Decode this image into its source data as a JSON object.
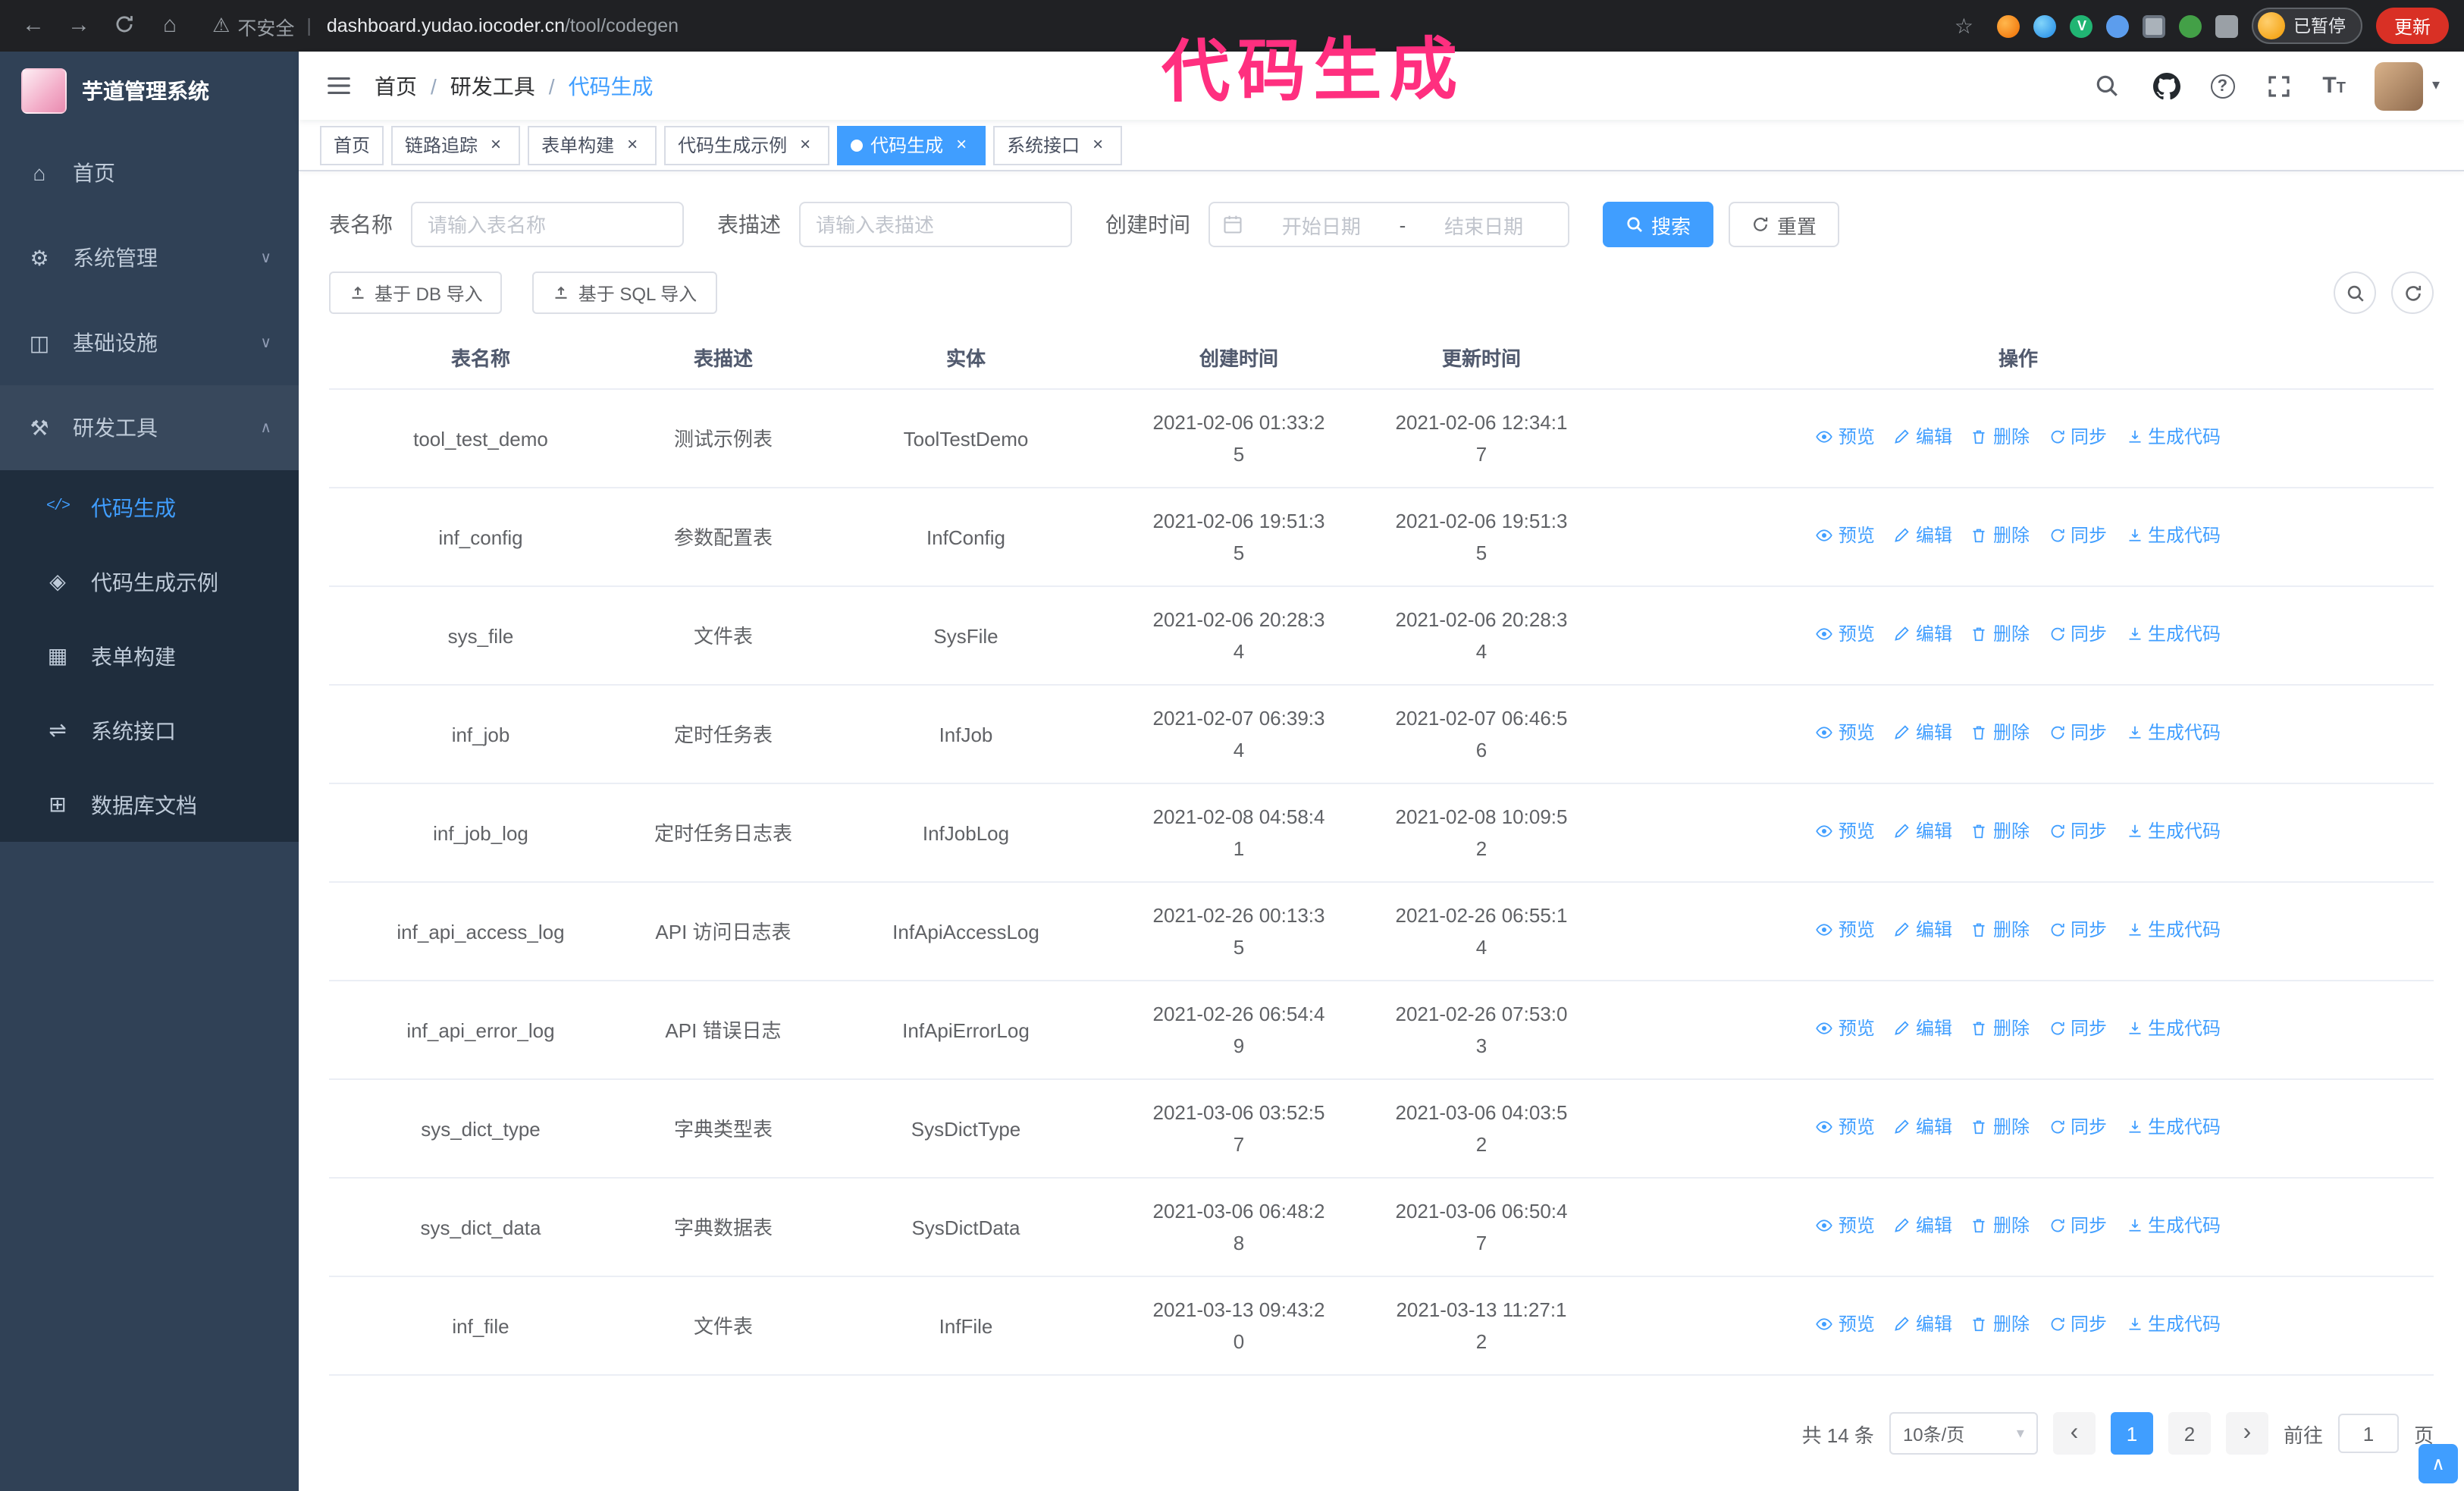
{
  "browser": {
    "security_label": "不安全",
    "url_host": "dashboard.yudao.iocoder.cn",
    "url_path": "/tool/codegen",
    "paused_badge": "已暂停",
    "update_button": "更新"
  },
  "annotation": {
    "text": "代码生成",
    "color": "#ff2f7f"
  },
  "sidebar": {
    "logo_title": "芋道管理系统",
    "items": [
      {
        "name": "home",
        "label": "首页",
        "icon": "home-icon",
        "glyph": "⌂"
      },
      {
        "name": "system-management",
        "label": "系统管理",
        "icon": "gear-icon",
        "glyph": "⚙",
        "chevron": "down"
      },
      {
        "name": "infrastructure",
        "label": "基础设施",
        "icon": "infrastructure-icon",
        "glyph": "◫",
        "chevron": "down"
      },
      {
        "name": "dev-tools",
        "label": "研发工具",
        "icon": "tools-icon",
        "glyph": "⚒",
        "chevron": "up",
        "expanded": true
      }
    ],
    "submenu": [
      {
        "name": "codegen",
        "label": "代码生成",
        "icon": "code-icon",
        "glyph": "</>",
        "active": true
      },
      {
        "name": "codegen-example",
        "label": "代码生成示例",
        "icon": "example-icon",
        "glyph": "◈"
      },
      {
        "name": "form-builder",
        "label": "表单构建",
        "icon": "form-icon",
        "glyph": "▦"
      },
      {
        "name": "system-api",
        "label": "系统接口",
        "icon": "api-icon",
        "glyph": "⇌"
      },
      {
        "name": "db-doc",
        "label": "数据库文档",
        "icon": "db-doc-icon",
        "glyph": "⊞"
      }
    ]
  },
  "header": {
    "breadcrumb": [
      "首页",
      "研发工具",
      "代码生成"
    ]
  },
  "tabs": [
    {
      "label": "首页",
      "closable": false,
      "active": false
    },
    {
      "label": "链路追踪",
      "closable": true,
      "active": false
    },
    {
      "label": "表单构建",
      "closable": true,
      "active": false
    },
    {
      "label": "代码生成示例",
      "closable": true,
      "active": false
    },
    {
      "label": "代码生成",
      "closable": true,
      "active": true
    },
    {
      "label": "系统接口",
      "closable": true,
      "active": false
    }
  ],
  "filters": {
    "table_name_label": "表名称",
    "table_name_placeholder": "请输入表名称",
    "table_desc_label": "表描述",
    "table_desc_placeholder": "请输入表描述",
    "create_time_label": "创建时间",
    "date_start_placeholder": "开始日期",
    "date_separator": "-",
    "date_end_placeholder": "结束日期",
    "search_button": "搜索",
    "reset_button": "重置"
  },
  "toolbar": {
    "import_db_button": "基于 DB 导入",
    "import_sql_button": "基于 SQL 导入"
  },
  "table": {
    "columns": [
      "表名称",
      "表描述",
      "实体",
      "创建时间",
      "更新时间",
      "操作"
    ],
    "actions": [
      {
        "label": "预览",
        "icon": "eye-icon"
      },
      {
        "label": "编辑",
        "icon": "edit-icon"
      },
      {
        "label": "删除",
        "icon": "delete-icon"
      },
      {
        "label": "同步",
        "icon": "sync-icon"
      },
      {
        "label": "生成代码",
        "icon": "generate-code-icon"
      }
    ],
    "rows": [
      {
        "name": "tool_test_demo",
        "desc": "测试示例表",
        "entity": "ToolTestDemo",
        "created": "2021-02-06 01:33:25",
        "updated": "2021-02-06 12:34:17"
      },
      {
        "name": "inf_config",
        "desc": "参数配置表",
        "entity": "InfConfig",
        "created": "2021-02-06 19:51:35",
        "updated": "2021-02-06 19:51:35"
      },
      {
        "name": "sys_file",
        "desc": "文件表",
        "entity": "SysFile",
        "created": "2021-02-06 20:28:34",
        "updated": "2021-02-06 20:28:34"
      },
      {
        "name": "inf_job",
        "desc": "定时任务表",
        "entity": "InfJob",
        "created": "2021-02-07 06:39:34",
        "updated": "2021-02-07 06:46:56"
      },
      {
        "name": "inf_job_log",
        "desc": "定时任务日志表",
        "entity": "InfJobLog",
        "created": "2021-02-08 04:58:41",
        "updated": "2021-02-08 10:09:52"
      },
      {
        "name": "inf_api_access_log",
        "desc": "API 访问日志表",
        "entity": "InfApiAccessLog",
        "created": "2021-02-26 00:13:35",
        "updated": "2021-02-26 06:55:14"
      },
      {
        "name": "inf_api_error_log",
        "desc": "API 错误日志",
        "entity": "InfApiErrorLog",
        "created": "2021-02-26 06:54:49",
        "updated": "2021-02-26 07:53:03"
      },
      {
        "name": "sys_dict_type",
        "desc": "字典类型表",
        "entity": "SysDictType",
        "created": "2021-03-06 03:52:57",
        "updated": "2021-03-06 04:03:52"
      },
      {
        "name": "sys_dict_data",
        "desc": "字典数据表",
        "entity": "SysDictData",
        "created": "2021-03-06 06:48:28",
        "updated": "2021-03-06 06:50:47"
      },
      {
        "name": "inf_file",
        "desc": "文件表",
        "entity": "InfFile",
        "created": "2021-03-13 09:43:20",
        "updated": "2021-03-13 11:27:12"
      }
    ]
  },
  "pagination": {
    "total_text": "共 14 条",
    "page_size": "10条/页",
    "pages": [
      "1",
      "2"
    ],
    "active_page": "1",
    "goto_prefix": "前往",
    "goto_value": "1",
    "goto_suffix": "页"
  },
  "colors": {
    "accent": "#409eff",
    "sidebar_bg": "#304156",
    "submenu_bg": "#1f2d3d",
    "annotation": "#ff2f7f",
    "update_button": "#d93025",
    "table_border": "#ebeef5"
  }
}
